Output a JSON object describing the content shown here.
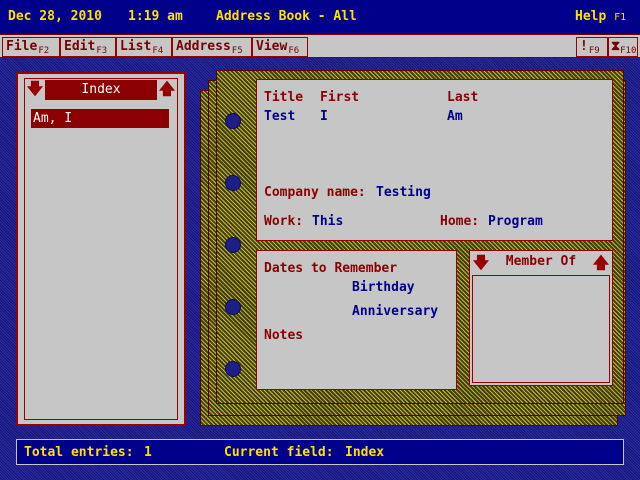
{
  "titlebar": {
    "date": "Dec 28, 2010",
    "time": "1:19 am",
    "title": "Address Book - All",
    "help_label": "Help",
    "help_key": "F1"
  },
  "menubar": {
    "items": [
      {
        "label": "File",
        "key": "F2"
      },
      {
        "label": "Edit",
        "key": "F3"
      },
      {
        "label": "List",
        "key": "F4"
      },
      {
        "label": "Address",
        "key": "F5"
      },
      {
        "label": "View",
        "key": "F6"
      }
    ],
    "right_items": [
      {
        "label": "!",
        "key": "F9"
      },
      {
        "label": "⧗",
        "key": "F10"
      }
    ]
  },
  "index_panel": {
    "title": "Index",
    "down_icon": "arrow-down-icon",
    "up_icon": "arrow-up-icon",
    "entries": [
      "Am, I"
    ]
  },
  "card": {
    "header": {
      "title_label": "Title",
      "first_label": "First",
      "last_label": "Last",
      "title_value": "Test",
      "first_value": "I",
      "last_value": "Am",
      "company_label": "Company name:",
      "company_value": "Testing",
      "work_label": "Work:",
      "work_value": "This",
      "home_label": "Home:",
      "home_value": "Program"
    },
    "dates": {
      "section_label": "Dates to Remember",
      "birthday_label": "Birthday",
      "anniversary_label": "Anniversary",
      "notes_label": "Notes"
    },
    "member_of": {
      "title": "Member Of"
    }
  },
  "statusbar": {
    "total_label": "Total entries:",
    "total_value": "1",
    "field_label": "Current field:",
    "field_value": "Index"
  },
  "colors": {
    "title_text": "#ffe000",
    "label_red": "#8b0000",
    "value_blue": "#00008a",
    "panel_gray": "#c6c6c6"
  }
}
